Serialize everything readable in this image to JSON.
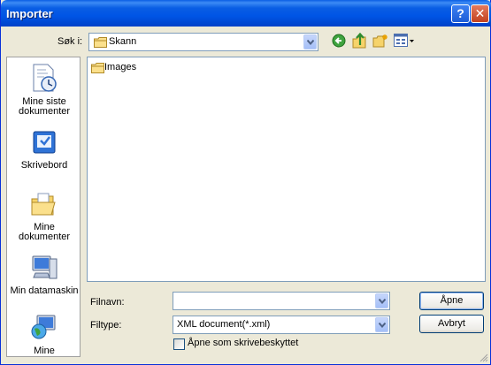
{
  "window": {
    "title": "Importer",
    "help_glyph": "?",
    "close_glyph": "✕"
  },
  "lookin": {
    "label": "Søk i:",
    "value": "Skann"
  },
  "places": [
    {
      "label": "Mine siste dokumenter",
      "icon": "recent-documents-icon"
    },
    {
      "label": "Skrivebord",
      "icon": "desktop-icon"
    },
    {
      "label": "Mine dokumenter",
      "icon": "my-documents-icon"
    },
    {
      "label": "Min datamaskin",
      "icon": "my-computer-icon"
    },
    {
      "label": "Mine",
      "icon": "network-places-icon"
    }
  ],
  "files": [
    {
      "name": "Images",
      "type": "folder"
    }
  ],
  "filename": {
    "label": "Filnavn:",
    "value": ""
  },
  "filetype": {
    "label": "Filtype:",
    "value": "XML document(*.xml)"
  },
  "buttons": {
    "open": "Åpne",
    "cancel": "Avbryt"
  },
  "readonly": {
    "label": "Åpne som skrivebeskyttet",
    "checked": false
  },
  "colors": {
    "titlebar": "#0A5EE4",
    "dialog_bg": "#ECE9D8",
    "field_border": "#7F9DB9"
  }
}
